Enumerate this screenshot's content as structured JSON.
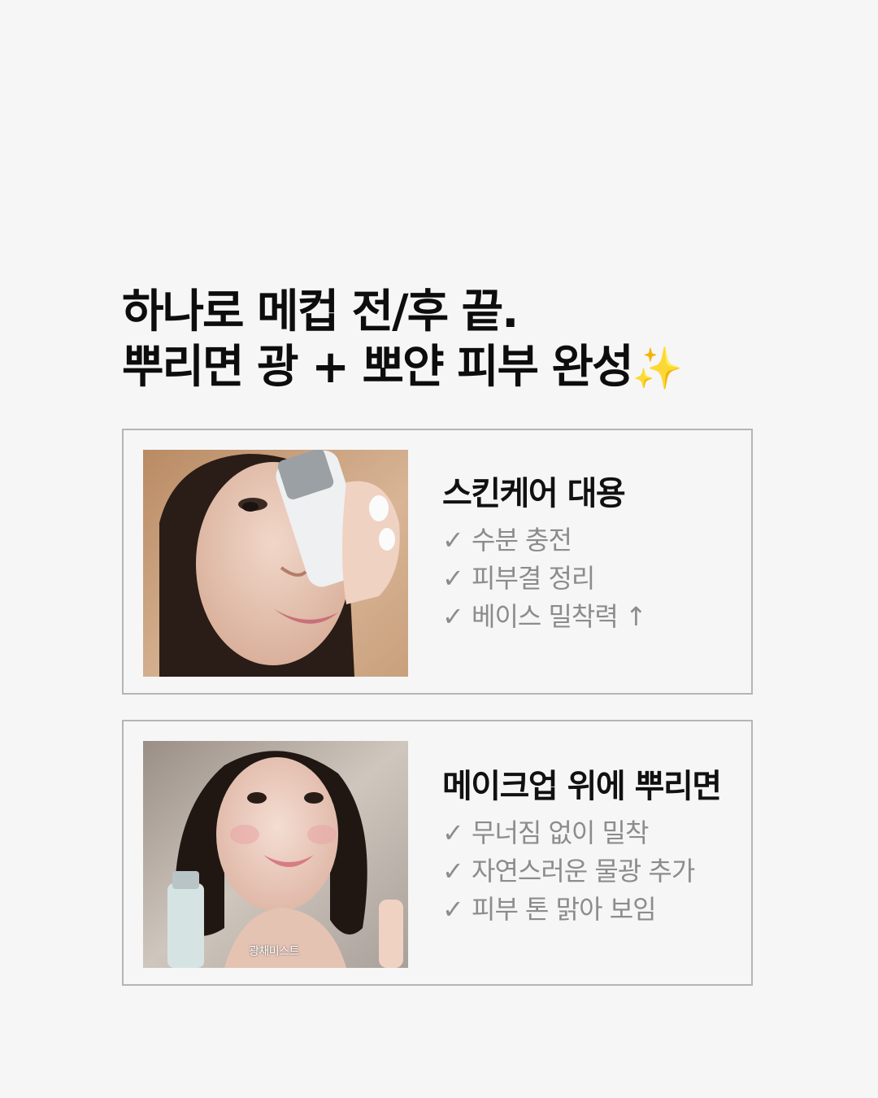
{
  "headline": {
    "line1": "하나로 메컵 전/후 끝.",
    "line2": "뿌리면 광 + 뽀얀 피부 완성",
    "sparkle": "✨"
  },
  "check_symbol": "✓",
  "cards": [
    {
      "title": "스킨케어 대용",
      "items": [
        "수분 충전",
        "피부결 정리",
        "베이스 밀착력 ↑"
      ]
    },
    {
      "title": "메이크업 위에 뿌리면",
      "items": [
        "무너짐 없이 밀착",
        "자연스러운 물광 추가",
        "피부 톤 맑아 보임"
      ],
      "photo_caption": "광채미스트"
    }
  ],
  "colors": {
    "background": "#f6f6f6",
    "card_border": "#b5b5b5",
    "muted_text": "#8c8c8c",
    "sparkle": "#f2c230"
  }
}
